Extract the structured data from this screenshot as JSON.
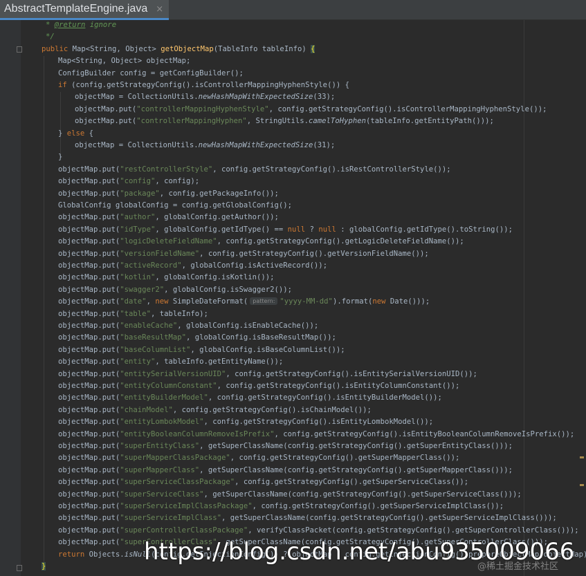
{
  "tab": {
    "label": "AbstractTemplateEngine.java",
    "close": "×"
  },
  "hint": "pattern:",
  "watermark": "https://blog.csdn.net/abu935009066",
  "watermark_small": "@稀土掘金技术社区",
  "code": [
    [
      [
        "doc",
        "* "
      ],
      [
        "doctag",
        "@return"
      ],
      [
        "doc",
        " ignore"
      ]
    ],
    [
      [
        "doc",
        "*/"
      ]
    ],
    [
      [
        "kw",
        "public "
      ],
      [
        "t",
        "Map<String, Object> "
      ],
      [
        "m",
        "getObjectMap"
      ],
      [
        "t",
        "(TableInfo tableInfo) "
      ],
      [
        "hl",
        "{"
      ]
    ],
    [
      [
        "t",
        "Map<String, Object> objectMap;"
      ]
    ],
    [
      [
        "t",
        "ConfigBuilder config = getConfigBuilder();"
      ]
    ],
    [
      [
        "kw",
        "if "
      ],
      [
        "t",
        "(config.getStrategyConfig().isControllerMappingHyphenStyle()) {"
      ]
    ],
    [
      [
        "t",
        "objectMap = CollectionUtils."
      ],
      [
        "it",
        "newHashMapWithExpectedSize"
      ],
      [
        "t",
        "(33);"
      ]
    ],
    [
      [
        "t",
        "objectMap.put("
      ],
      [
        "str",
        "\"controllerMappingHyphenStyle\""
      ],
      [
        "t",
        ", config.getStrategyConfig().isControllerMappingHyphenStyle());"
      ]
    ],
    [
      [
        "t",
        "objectMap.put("
      ],
      [
        "str",
        "\"controllerMappingHyphen\""
      ],
      [
        "t",
        ", StringUtils."
      ],
      [
        "it",
        "camelToHyphen"
      ],
      [
        "t",
        "(tableInfo.getEntityPath()));"
      ]
    ],
    [
      [
        "t",
        "} "
      ],
      [
        "kw",
        "else "
      ],
      [
        "t",
        "{"
      ]
    ],
    [
      [
        "t",
        "objectMap = CollectionUtils."
      ],
      [
        "it",
        "newHashMapWithExpectedSize"
      ],
      [
        "t",
        "(31);"
      ]
    ],
    [
      [
        "t",
        "}"
      ]
    ],
    [
      [
        "t",
        "objectMap.put("
      ],
      [
        "str",
        "\"restControllerStyle\""
      ],
      [
        "t",
        ", config.getStrategyConfig().isRestControllerStyle());"
      ]
    ],
    [
      [
        "t",
        "objectMap.put("
      ],
      [
        "str",
        "\"config\""
      ],
      [
        "t",
        ", config);"
      ]
    ],
    [
      [
        "t",
        "objectMap.put("
      ],
      [
        "str",
        "\"package\""
      ],
      [
        "t",
        ", config.getPackageInfo());"
      ]
    ],
    [
      [
        "t",
        "GlobalConfig globalConfig = config.getGlobalConfig();"
      ]
    ],
    [
      [
        "t",
        "objectMap.put("
      ],
      [
        "str",
        "\"author\""
      ],
      [
        "t",
        ", globalConfig.getAuthor());"
      ]
    ],
    [
      [
        "t",
        "objectMap.put("
      ],
      [
        "str",
        "\"idType\""
      ],
      [
        "t",
        ", globalConfig.getIdType() == "
      ],
      [
        "kw",
        "null "
      ],
      [
        "t",
        "? "
      ],
      [
        "kw",
        "null "
      ],
      [
        "t",
        ": globalConfig.getIdType().toString());"
      ]
    ],
    [
      [
        "t",
        "objectMap.put("
      ],
      [
        "str",
        "\"logicDeleteFieldName\""
      ],
      [
        "t",
        ", config.getStrategyConfig().getLogicDeleteFieldName());"
      ]
    ],
    [
      [
        "t",
        "objectMap.put("
      ],
      [
        "str",
        "\"versionFieldName\""
      ],
      [
        "t",
        ", config.getStrategyConfig().getVersionFieldName());"
      ]
    ],
    [
      [
        "t",
        "objectMap.put("
      ],
      [
        "str",
        "\"activeRecord\""
      ],
      [
        "t",
        ", globalConfig.isActiveRecord());"
      ]
    ],
    [
      [
        "t",
        "objectMap.put("
      ],
      [
        "str",
        "\"kotlin\""
      ],
      [
        "t",
        ", globalConfig.isKotlin());"
      ]
    ],
    [
      [
        "t",
        "objectMap.put("
      ],
      [
        "str",
        "\"swagger2\""
      ],
      [
        "t",
        ", globalConfig.isSwagger2());"
      ]
    ],
    [
      [
        "t",
        "objectMap.put("
      ],
      [
        "str",
        "\"date\""
      ],
      [
        "t",
        ", "
      ],
      [
        "kw",
        "new "
      ],
      [
        "t",
        "SimpleDateFormat("
      ],
      [
        "hint",
        ""
      ],
      [
        "str",
        "\"yyyy-MM-dd\""
      ],
      [
        "t",
        ").format("
      ],
      [
        "kw",
        "new "
      ],
      [
        "t",
        "Date()));"
      ]
    ],
    [
      [
        "t",
        "objectMap.put("
      ],
      [
        "str",
        "\"table\""
      ],
      [
        "t",
        ", tableInfo);"
      ]
    ],
    [
      [
        "t",
        "objectMap.put("
      ],
      [
        "str",
        "\"enableCache\""
      ],
      [
        "t",
        ", globalConfig.isEnableCache());"
      ]
    ],
    [
      [
        "t",
        "objectMap.put("
      ],
      [
        "str",
        "\"baseResultMap\""
      ],
      [
        "t",
        ", globalConfig.isBaseResultMap());"
      ]
    ],
    [
      [
        "t",
        "objectMap.put("
      ],
      [
        "str",
        "\"baseColumnList\""
      ],
      [
        "t",
        ", globalConfig.isBaseColumnList());"
      ]
    ],
    [
      [
        "t",
        "objectMap.put("
      ],
      [
        "str",
        "\"entity\""
      ],
      [
        "t",
        ", tableInfo.getEntityName());"
      ]
    ],
    [
      [
        "t",
        "objectMap.put("
      ],
      [
        "str",
        "\"entitySerialVersionUID\""
      ],
      [
        "t",
        ", config.getStrategyConfig().isEntitySerialVersionUID());"
      ]
    ],
    [
      [
        "t",
        "objectMap.put("
      ],
      [
        "str",
        "\"entityColumnConstant\""
      ],
      [
        "t",
        ", config.getStrategyConfig().isEntityColumnConstant());"
      ]
    ],
    [
      [
        "t",
        "objectMap.put("
      ],
      [
        "str",
        "\"entityBuilderModel\""
      ],
      [
        "t",
        ", config.getStrategyConfig().isEntityBuilderModel());"
      ]
    ],
    [
      [
        "t",
        "objectMap.put("
      ],
      [
        "str",
        "\"chainModel\""
      ],
      [
        "t",
        ", config.getStrategyConfig().isChainModel());"
      ]
    ],
    [
      [
        "t",
        "objectMap.put("
      ],
      [
        "str",
        "\"entityLombokModel\""
      ],
      [
        "t",
        ", config.getStrategyConfig().isEntityLombokModel());"
      ]
    ],
    [
      [
        "t",
        "objectMap.put("
      ],
      [
        "str",
        "\"entityBooleanColumnRemoveIsPrefix\""
      ],
      [
        "t",
        ", config.getStrategyConfig().isEntityBooleanColumnRemoveIsPrefix());"
      ]
    ],
    [
      [
        "t",
        "objectMap.put("
      ],
      [
        "str",
        "\"superEntityClass\""
      ],
      [
        "t",
        ", getSuperClassName(config.getStrategyConfig().getSuperEntityClass()));"
      ]
    ],
    [
      [
        "t",
        "objectMap.put("
      ],
      [
        "str",
        "\"superMapperClassPackage\""
      ],
      [
        "t",
        ", config.getStrategyConfig().getSuperMapperClass());"
      ]
    ],
    [
      [
        "t",
        "objectMap.put("
      ],
      [
        "str",
        "\"superMapperClass\""
      ],
      [
        "t",
        ", getSuperClassName(config.getStrategyConfig().getSuperMapperClass()));"
      ]
    ],
    [
      [
        "t",
        "objectMap.put("
      ],
      [
        "str",
        "\"superServiceClassPackage\""
      ],
      [
        "t",
        ", config.getStrategyConfig().getSuperServiceClass());"
      ]
    ],
    [
      [
        "t",
        "objectMap.put("
      ],
      [
        "str",
        "\"superServiceClass\""
      ],
      [
        "t",
        ", getSuperClassName(config.getStrategyConfig().getSuperServiceClass()));"
      ]
    ],
    [
      [
        "t",
        "objectMap.put("
      ],
      [
        "str",
        "\"superServiceImplClassPackage\""
      ],
      [
        "t",
        ", config.getStrategyConfig().getSuperServiceImplClass());"
      ]
    ],
    [
      [
        "t",
        "objectMap.put("
      ],
      [
        "str",
        "\"superServiceImplClass\""
      ],
      [
        "t",
        ", getSuperClassName(config.getStrategyConfig().getSuperServiceImplClass()));"
      ]
    ],
    [
      [
        "t",
        "objectMap.put("
      ],
      [
        "str",
        "\"superControllerClassPackage\""
      ],
      [
        "t",
        ", verifyClassPacket(config.getStrategyConfig().getSuperControllerClass()));"
      ]
    ],
    [
      [
        "t",
        "objectMap.put("
      ],
      [
        "str",
        "\"superControllerClass\""
      ],
      [
        "t",
        ", getSuperClassName(config.getStrategyConfig().getSuperControllerClass()));"
      ]
    ],
    [
      [
        "kw",
        "return "
      ],
      [
        "t",
        "Objects."
      ],
      [
        "it",
        "isNull"
      ],
      [
        "t",
        "(config.getInjectionConfig()) ? objectMap : config.getInjectionConfig().prepareObjectMap(objectMap);"
      ]
    ],
    [
      [
        "hl",
        "}"
      ]
    ]
  ]
}
